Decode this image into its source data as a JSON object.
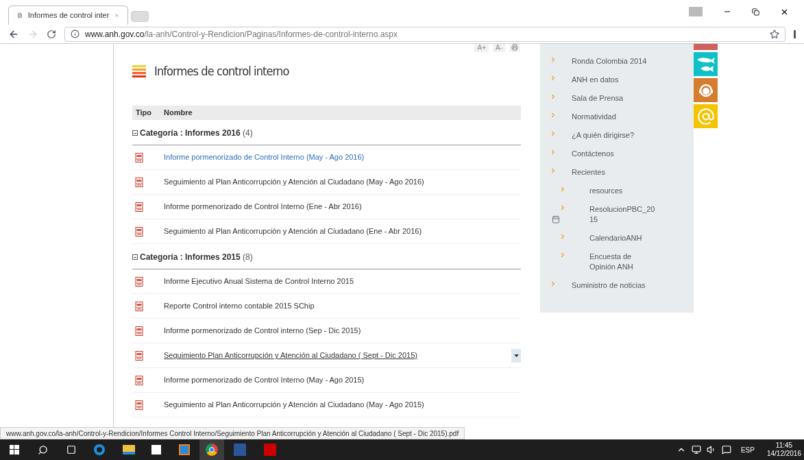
{
  "browser": {
    "tab_title": "Informes de control inter",
    "url_host": "www.anh.gov.co",
    "url_path": "/la-anh/Control-y-Rendicion/Paginas/Informes-de-control-interno.aspx"
  },
  "toolbar": [
    "A+",
    "A-"
  ],
  "page_title": "Informes de control interno",
  "table": {
    "columns": [
      "Tipo",
      "Nombre"
    ],
    "groups": [
      {
        "label": "Categoría : Informes 2016",
        "count": "(4)",
        "expanded": true,
        "files": [
          {
            "name": "Informe pormenorizado de Control Interno (May - Ago 2016)",
            "highlighted": true,
            "hovered": false
          },
          {
            "name": "Seguimiento al Plan Anticorrupción y Atención al Ciudadano (May - Ago 2016)",
            "highlighted": false,
            "hovered": false
          },
          {
            "name": "Informe pormenorizado de Control Interno (Ene - Abr 2016)",
            "highlighted": false,
            "hovered": false
          },
          {
            "name": "Seguimiento al Plan Anticorrupción y Atención al Ciudadano (Ene - Abr 2016)",
            "highlighted": false,
            "hovered": false
          }
        ]
      },
      {
        "label": "Categoría : Informes 2015",
        "count": "(8)",
        "expanded": true,
        "files": [
          {
            "name": "Informe Ejecutivo Anual Sistema de Control Interno 2015",
            "highlighted": false,
            "hovered": false
          },
          {
            "name": "Reporte Control interno contable 2015 SChip",
            "highlighted": false,
            "hovered": false
          },
          {
            "name": "Informe pormenorizado de Control interno (Sep - Dic 2015)",
            "highlighted": false,
            "hovered": false
          },
          {
            "name": "Seguimiento Plan Anticorrupción y Atención al Ciudadano ( Sept - Dic 2015)",
            "highlighted": false,
            "hovered": true
          },
          {
            "name": "Informe pormenorizado de Control Interno (May - Ago 2015)",
            "highlighted": false,
            "hovered": false
          },
          {
            "name": "Seguimiento al Plan Anticorrupción y Atención al Ciudadano (May - Ago 2015)",
            "highlighted": false,
            "hovered": false
          }
        ]
      }
    ]
  },
  "sidebar": {
    "items": [
      {
        "label": "Ronda Colombia 2014"
      },
      {
        "label": "ANH en datos"
      },
      {
        "label": "Sala de Prensa"
      },
      {
        "label": "Normatividad"
      },
      {
        "label": "¿A quién dirigirse?"
      },
      {
        "label": "Contáctenos"
      },
      {
        "label": "Recientes",
        "children": [
          {
            "label": "resources"
          },
          {
            "label": "ResolucionPBC_20\n15"
          },
          {
            "label": "CalendarioANH"
          },
          {
            "label": "Encuesta de\nOpinión ANH"
          }
        ]
      },
      {
        "label": "Suministro de noticias"
      }
    ]
  },
  "status_url": "www.anh.gov.co/la-anh/Control-y-Rendicion/Informes Control Interno/Seguimiento Plan Anticorrupción y Atención al Ciudadano ( Sept - Dic 2015).pdf",
  "taskbar": {
    "language": "ESP",
    "time": "11:45",
    "date": "14/12/2016"
  }
}
